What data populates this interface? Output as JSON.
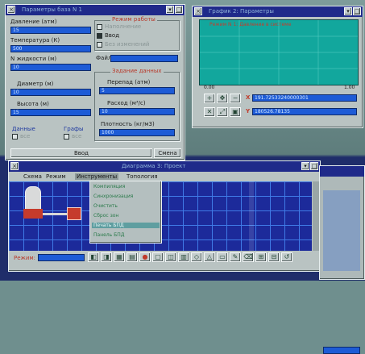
{
  "win1": {
    "title": "Параметры база N 1",
    "fields": [
      {
        "label": "Давление (атм)",
        "value": "15"
      },
      {
        "label": "Температура (К)",
        "value": "500"
      },
      {
        "label": "N жидкости (м)",
        "value": "10"
      },
      {
        "label": "Диаметр (м)",
        "value": "10"
      },
      {
        "label": "Высота (м)",
        "value": "15"
      }
    ],
    "mode_group": "Режим работы",
    "mode_options": [
      "Наполнение",
      "Ввод",
      "Без изменений"
    ],
    "file_label": "Файл",
    "flow_group": "Задание данных",
    "flow_fields": [
      {
        "label": "Перепад (атм)",
        "value": "5"
      },
      {
        "label": "Расход (м³/с)",
        "value": "10"
      },
      {
        "label": "Плотность (кг/м3)",
        "value": "1000"
      }
    ],
    "check_left": "Данные",
    "check_left_sub": "все",
    "check_right": "Графы",
    "check_right_sub": "все",
    "btn_enter": "Ввод",
    "btn_reset": "Смена"
  },
  "win2": {
    "title": "График 2: Параметры",
    "chart_title": "Режим N 1: Давление в системе",
    "axis_left": "0.00",
    "axis_right": "1.00",
    "readout_x_label": "X",
    "readout_x": "191.72533240000301",
    "readout_y_label": "Y",
    "readout_y": "180526.78135"
  },
  "win3": {
    "title": "Диаграмма 3: Проект",
    "menus": [
      "Схема",
      "Режим",
      "Инструменты",
      "Топология"
    ],
    "dropdown": [
      "Компиляция",
      "Синхронизация",
      "Очистить",
      "Сброс зон",
      "Печать БПД",
      "Панель БПД"
    ],
    "status_label": "Режим:"
  },
  "colors": {
    "titlebar": "#1f2a8a",
    "field": "#1d5bd6",
    "grid_bg": "#1c2a9a",
    "grid_line": "#3f7ae6",
    "chart_bg": "#12a79d",
    "accent_red": "#c03a2a"
  }
}
